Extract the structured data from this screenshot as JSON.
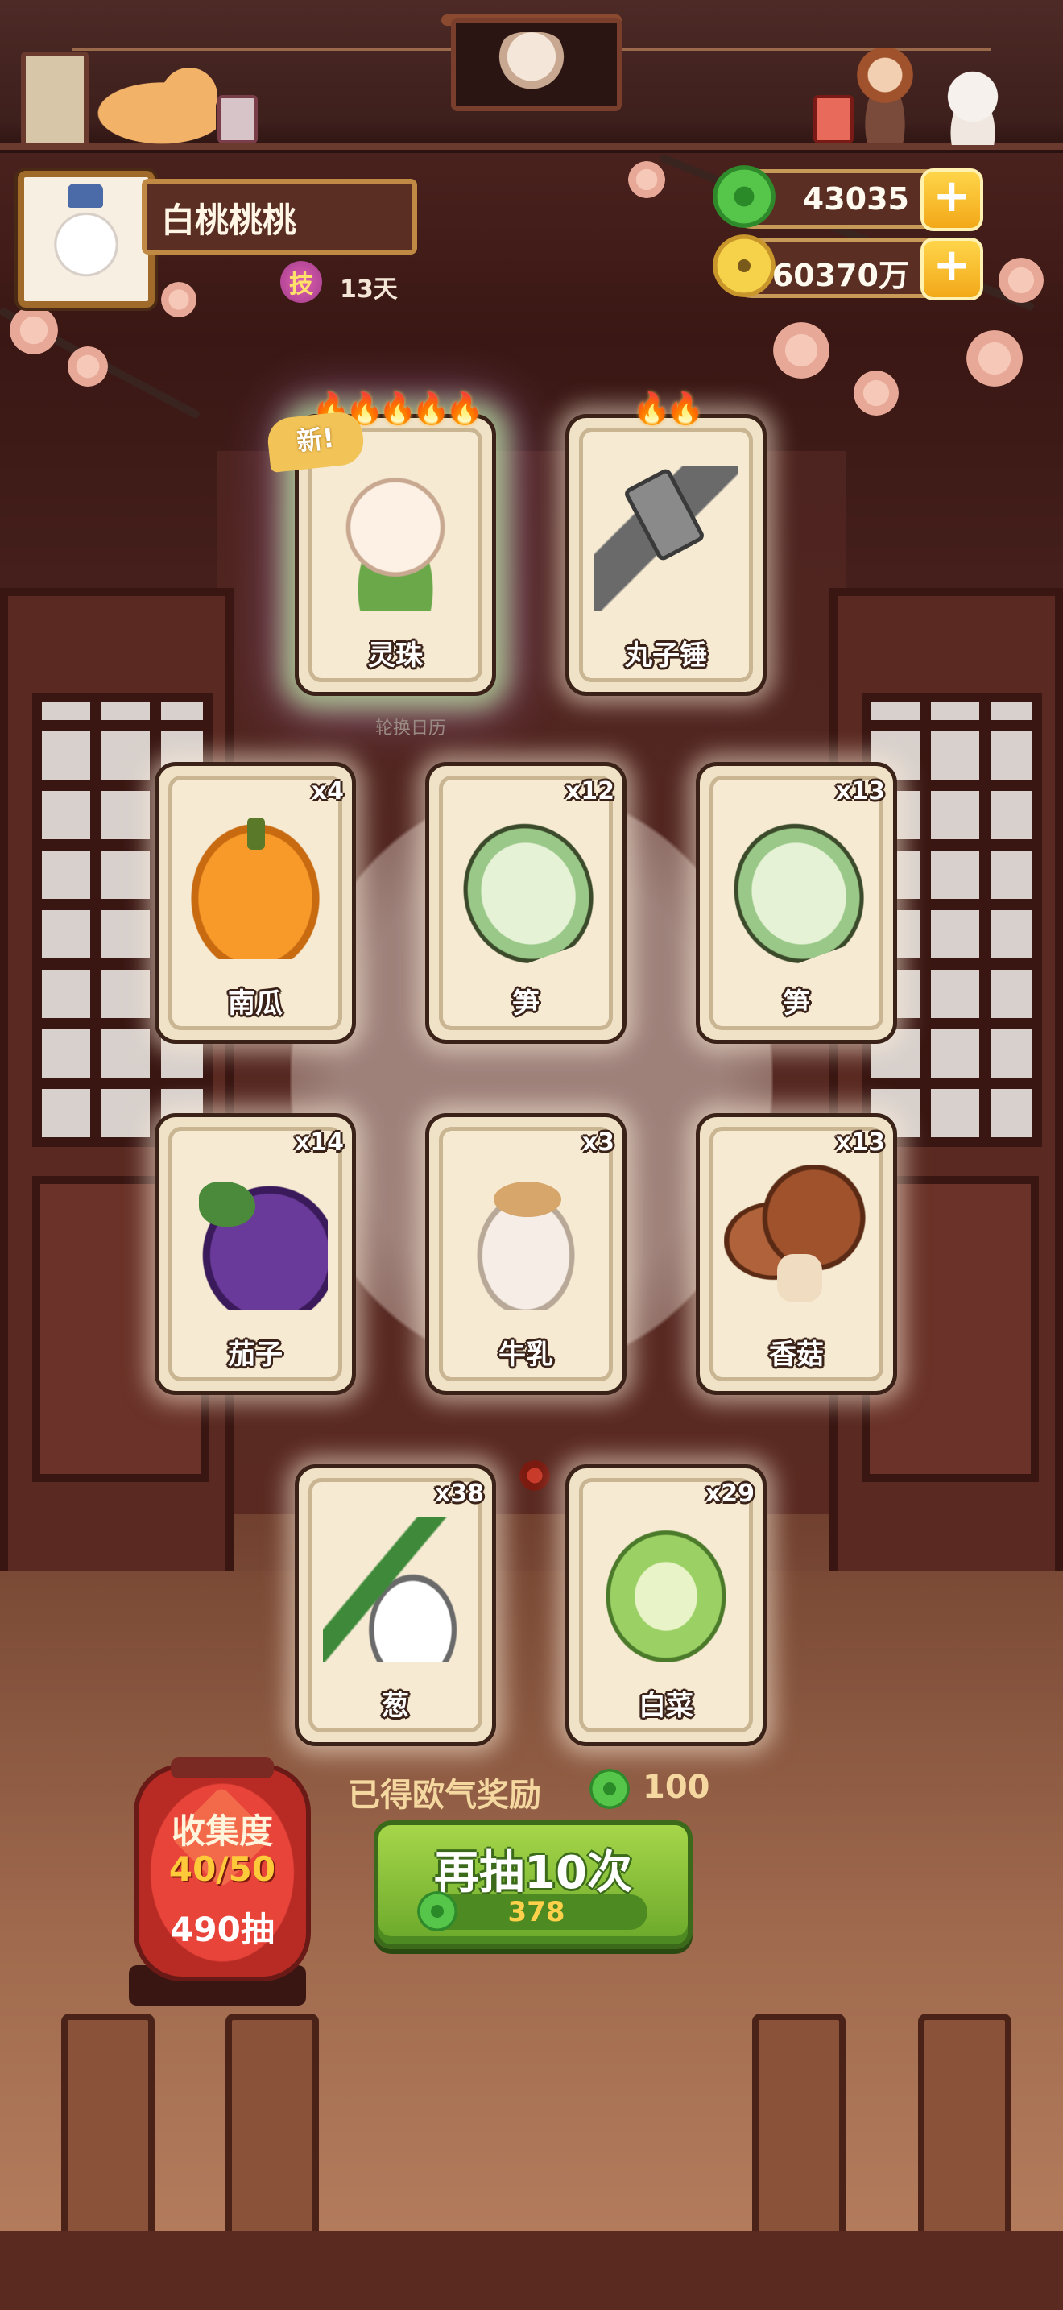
{
  "profile": {
    "name": "白桃桃桃",
    "skill_badge": "技",
    "skill_days": "13天"
  },
  "currency": {
    "jade": "43035",
    "coins": "60370万"
  },
  "featured": [
    {
      "name": "灵珠",
      "tag": "新!",
      "flames": "🔥🔥🔥🔥🔥"
    },
    {
      "name": "丸子锤",
      "flames": "🔥🔥"
    }
  ],
  "calendar_label": "轮换日历",
  "cards": [
    {
      "name": "南瓜",
      "count": "x4",
      "icon": "pumpkin-icon"
    },
    {
      "name": "笋",
      "count": "x12",
      "icon": "bamboo-shoot-icon"
    },
    {
      "name": "笋",
      "count": "x13",
      "icon": "bamboo-shoot-icon"
    },
    {
      "name": "茄子",
      "count": "x14",
      "icon": "eggplant-icon"
    },
    {
      "name": "牛乳",
      "count": "x3",
      "icon": "milk-jar-icon"
    },
    {
      "name": "香菇",
      "count": "x13",
      "icon": "mushroom-icon"
    },
    {
      "name": "葱",
      "count": "x38",
      "icon": "scallion-icon"
    },
    {
      "name": "白菜",
      "count": "x29",
      "icon": "cabbage-icon"
    }
  ],
  "reward": {
    "label": "已得欧气奖励",
    "value": "100"
  },
  "collection": {
    "title": "收集度",
    "progress": "40/50",
    "draws": "490抽"
  },
  "draw_button": {
    "label": "再抽10次",
    "cost": "378"
  },
  "colors": {
    "button_green": "#8cc63a",
    "gold": "#f2b82a",
    "card_bg": "#efe2c6"
  }
}
